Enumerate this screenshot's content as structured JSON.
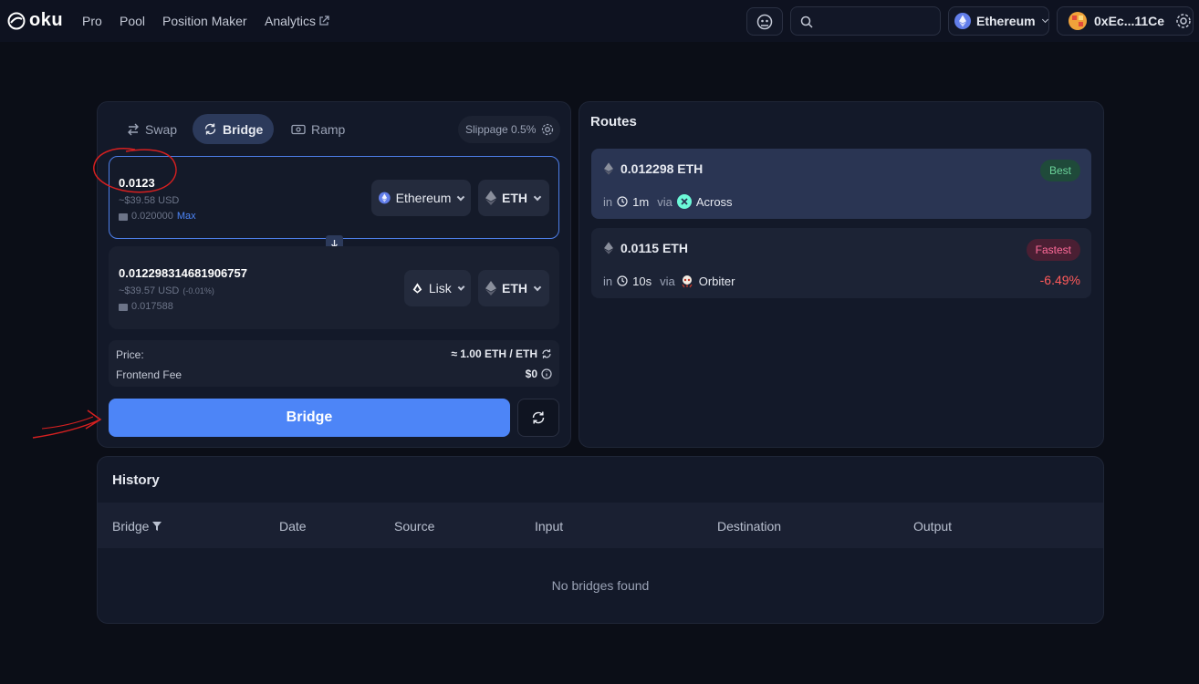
{
  "nav": {
    "logo": "oku",
    "links": [
      "Pro",
      "Pool",
      "Position Maker",
      "Analytics"
    ],
    "network": "Ethereum",
    "account": "0xEc...11Ce"
  },
  "tabs": {
    "swap": "Swap",
    "bridge": "Bridge",
    "ramp": "Ramp"
  },
  "slippage": "Slippage 0.5%",
  "from": {
    "amount": "0.0123",
    "usd": "~$39.58 USD",
    "balance": "0.020000",
    "max": "Max",
    "network": "Ethereum",
    "token": "ETH"
  },
  "to": {
    "amount": "0.012298314681906757",
    "usd": "~$39.57 USD",
    "usd_change": "(-0.01%)",
    "balance": "0.017588",
    "network": "Lisk",
    "token": "ETH"
  },
  "info": {
    "price_label": "Price:",
    "price_value": "≈ 1.00 ETH / ETH",
    "fee_label": "Frontend Fee",
    "fee_value": "$0"
  },
  "bridge_button": "Bridge",
  "routes": {
    "title": "Routes",
    "items": [
      {
        "amount": "0.012298 ETH",
        "in": "in",
        "time": "1m",
        "via": "via",
        "provider": "Across",
        "badge": "Best",
        "delta": ""
      },
      {
        "amount": "0.0115 ETH",
        "in": "in",
        "time": "10s",
        "via": "via",
        "provider": "Orbiter",
        "badge": "Fastest",
        "delta": "-6.49%"
      }
    ]
  },
  "history": {
    "title": "History",
    "columns": [
      "Bridge",
      "Date",
      "Source",
      "Input",
      "Destination",
      "Output"
    ],
    "empty": "No bridges found"
  },
  "colors": {
    "accent": "#4d85f7",
    "best": "#6bd39a",
    "fastest": "#ff6b9a",
    "negative": "#ff5a5a",
    "annotation": "#d62020"
  }
}
